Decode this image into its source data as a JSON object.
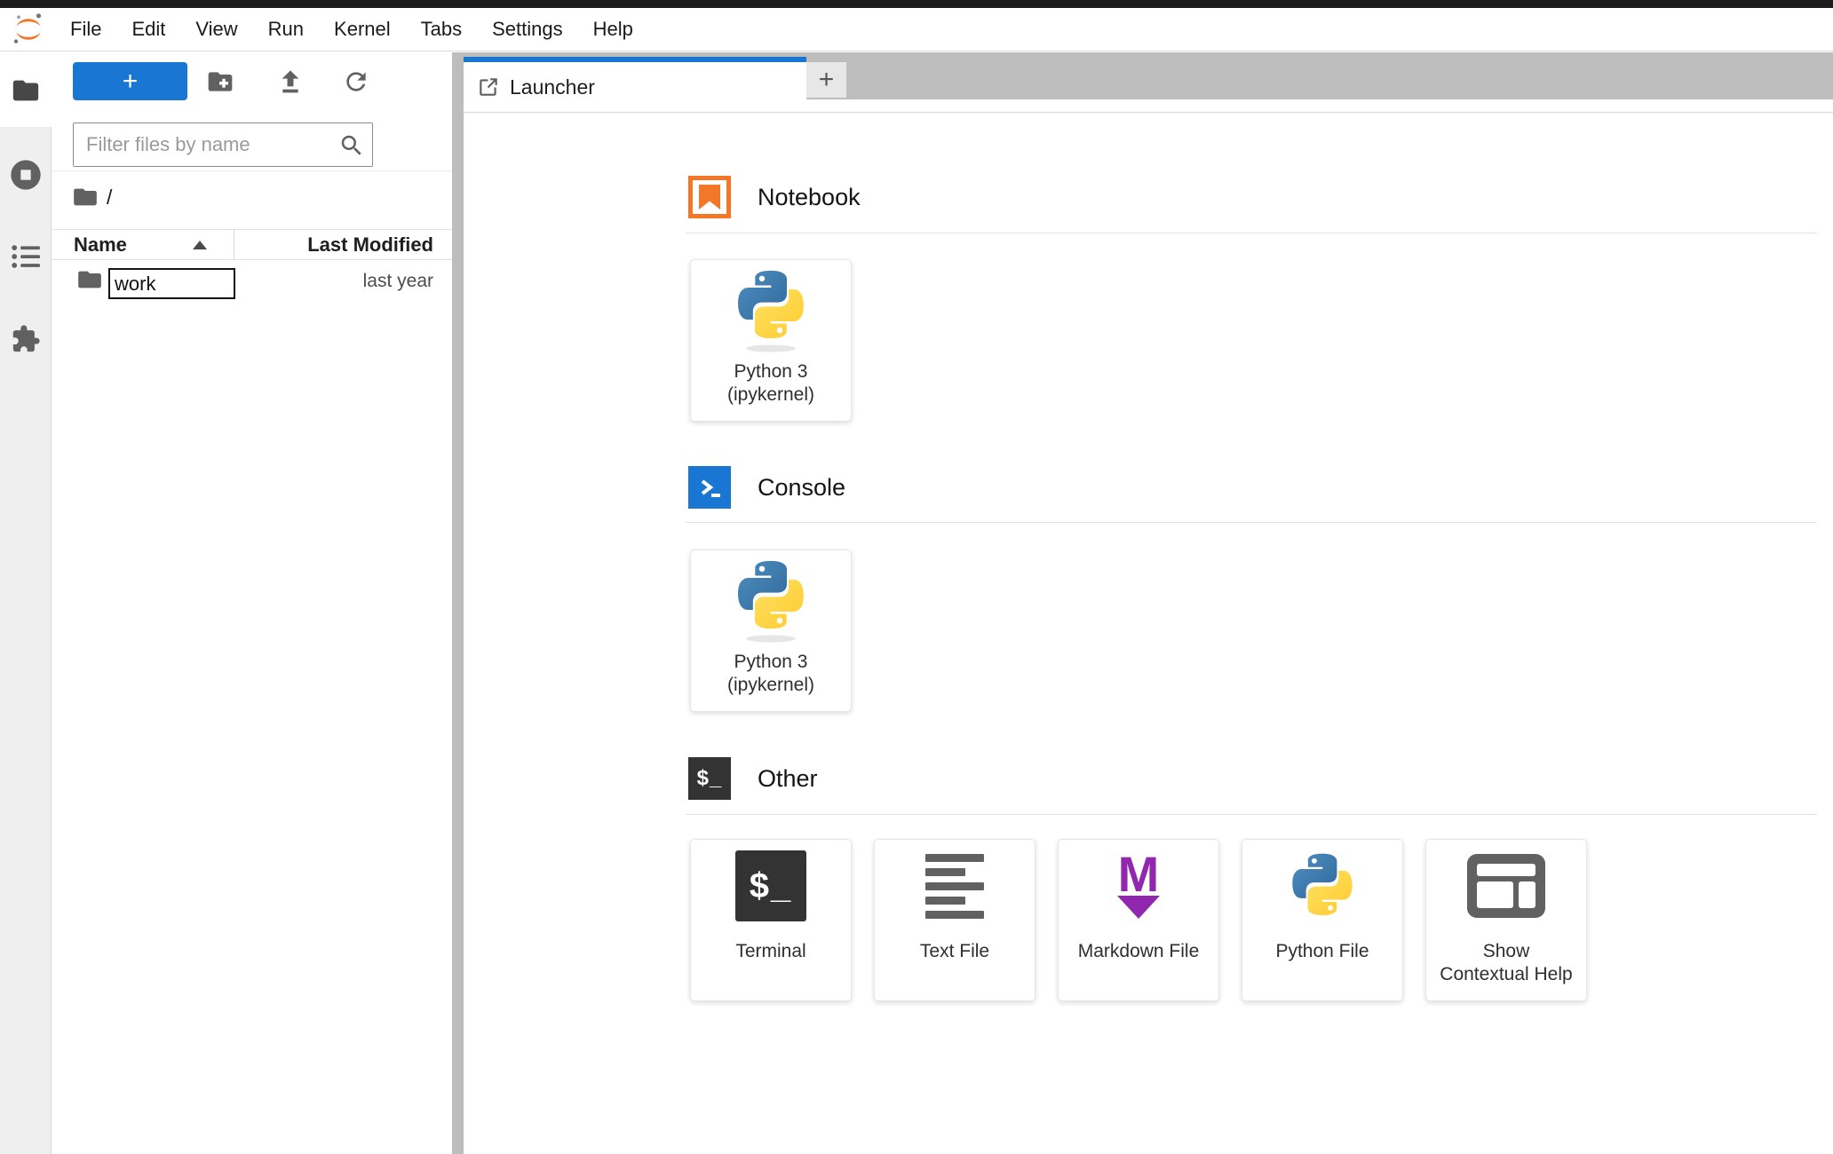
{
  "menu_bar": {
    "items": [
      "File",
      "Edit",
      "View",
      "Run",
      "Kernel",
      "Tabs",
      "Settings",
      "Help"
    ]
  },
  "activity_bar": {
    "icons": [
      "folder-icon",
      "running-sessions-icon",
      "table-of-contents-icon",
      "extension-manager-icon"
    ]
  },
  "file_browser": {
    "new_launcher_button": "+",
    "toolbar_icons": [
      "new-folder-icon",
      "upload-icon",
      "refresh-icon"
    ],
    "filter_placeholder": "Filter files by name",
    "breadcrumb_root": "/",
    "columns": {
      "name": "Name",
      "last_modified": "Last Modified"
    },
    "sort": "ascending",
    "rows": [
      {
        "name": "work",
        "last_modified": "last year",
        "renaming": true
      }
    ]
  },
  "tab_bar": {
    "tabs": [
      {
        "label": "Launcher",
        "icon": "launcher-icon",
        "active": true
      }
    ],
    "add_tab": "+"
  },
  "launcher": {
    "sections": [
      {
        "title": "Notebook",
        "icon": "notebook-icon",
        "cards": [
          {
            "icon": "python-icon",
            "lines": [
              "Python 3",
              "(ipykernel)"
            ]
          }
        ]
      },
      {
        "title": "Console",
        "icon": "console-icon",
        "cards": [
          {
            "icon": "python-icon",
            "lines": [
              "Python 3",
              "(ipykernel)"
            ]
          }
        ]
      },
      {
        "title": "Other",
        "icon": "terminal-icon",
        "cards": [
          {
            "icon": "terminal-icon",
            "lines": [
              "Terminal"
            ]
          },
          {
            "icon": "text-file-icon",
            "lines": [
              "Text File"
            ]
          },
          {
            "icon": "markdown-icon",
            "lines": [
              "Markdown File"
            ]
          },
          {
            "icon": "python-icon",
            "lines": [
              "Python File"
            ]
          },
          {
            "icon": "inspector-icon",
            "lines": [
              "Show",
              "Contextual Help"
            ]
          }
        ]
      }
    ]
  },
  "glyphs": {
    "terminal_prompt": "$_",
    "markdown_m": "M"
  },
  "colors": {
    "accent_blue": "#1976d2",
    "jupyter_orange": "#f37726",
    "terminal_dark": "#333333",
    "markdown_purple": "#9127ae",
    "icon_gray": "#616161",
    "tab_bar_gray": "#bdbdbd",
    "python_blue": "#3b77a9",
    "python_yellow": "#ffd43b"
  }
}
